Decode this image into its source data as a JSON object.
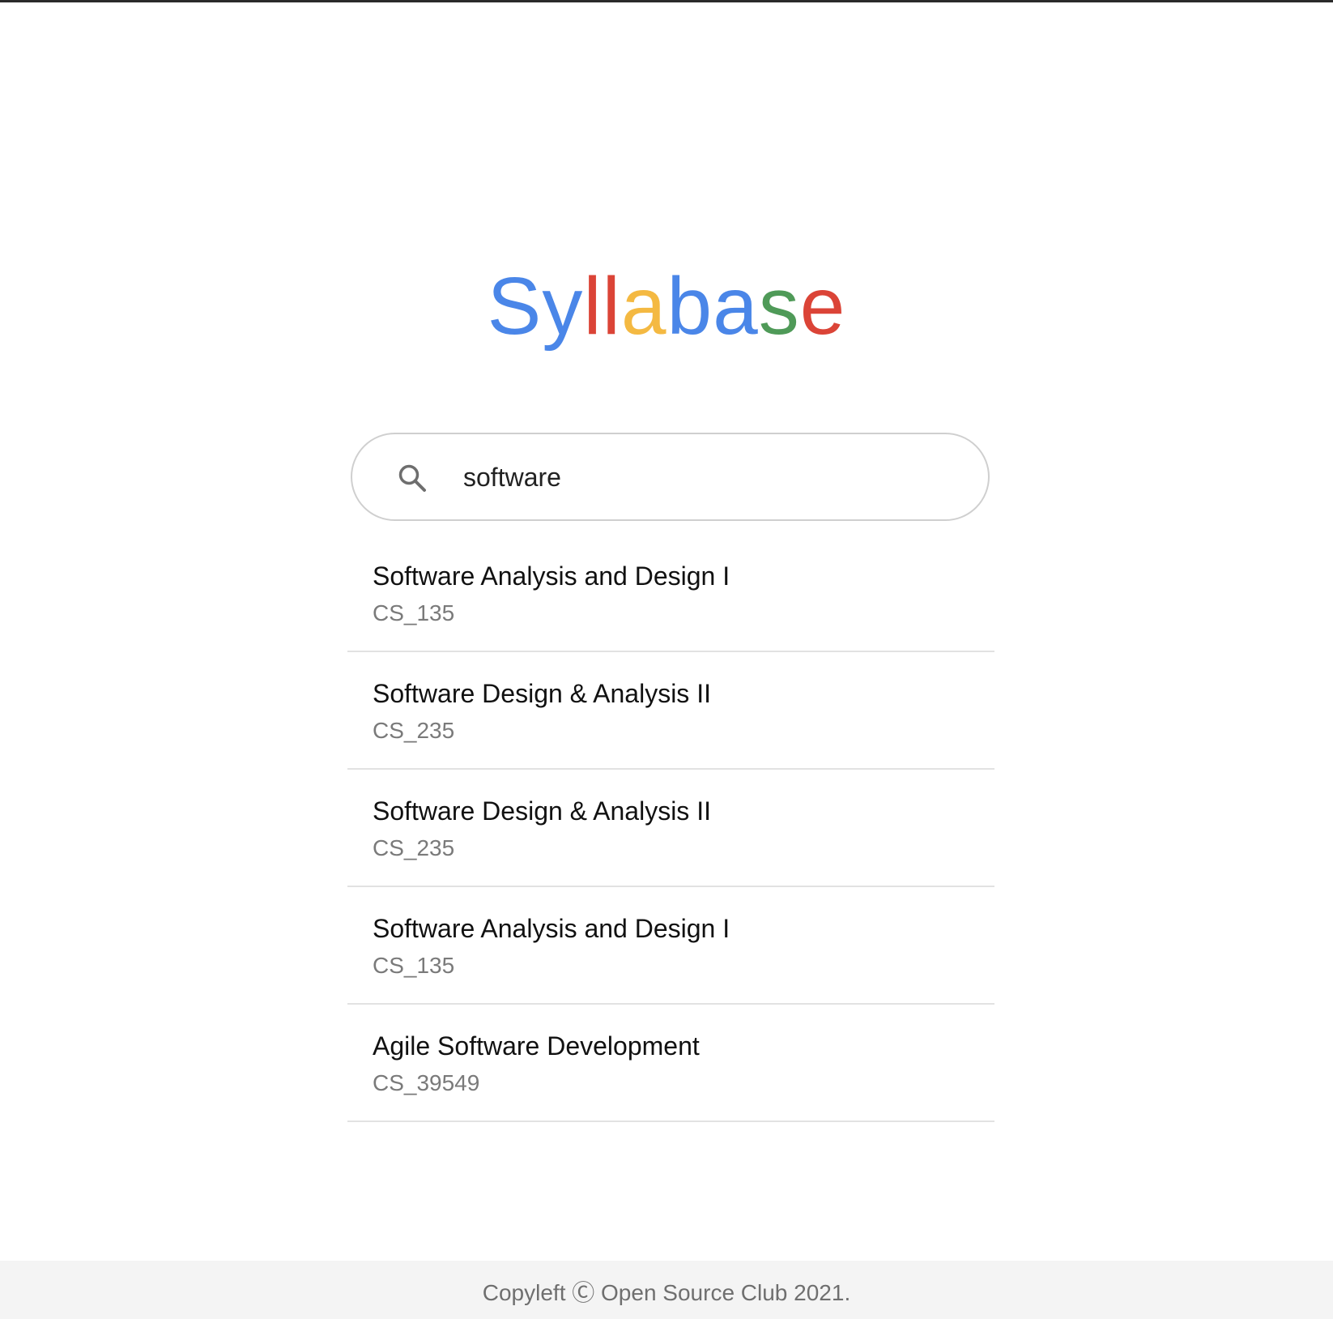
{
  "logo": {
    "letters": [
      {
        "char": "S",
        "color": "#4a86e8"
      },
      {
        "char": "y",
        "color": "#4a86e8"
      },
      {
        "char": "l",
        "color": "#db4437"
      },
      {
        "char": "l",
        "color": "#db4437"
      },
      {
        "char": "a",
        "color": "#f4b942"
      },
      {
        "char": "b",
        "color": "#4a86e8"
      },
      {
        "char": "a",
        "color": "#4a86e8"
      },
      {
        "char": "s",
        "color": "#4f9a58"
      },
      {
        "char": "e",
        "color": "#db4437"
      }
    ]
  },
  "search": {
    "icon": "search-icon",
    "value": "software",
    "placeholder": ""
  },
  "results": [
    {
      "title": "Software Analysis and Design I",
      "code": "CS_135"
    },
    {
      "title": "Software Design & Analysis II",
      "code": "CS_235"
    },
    {
      "title": "Software Design & Analysis II",
      "code": "CS_235"
    },
    {
      "title": "Software Analysis and Design I",
      "code": "CS_135"
    },
    {
      "title": "Agile Software Development",
      "code": "CS_39549"
    }
  ],
  "footer": {
    "text": "Copyleft Ⓒ Open Source Club 2021."
  }
}
